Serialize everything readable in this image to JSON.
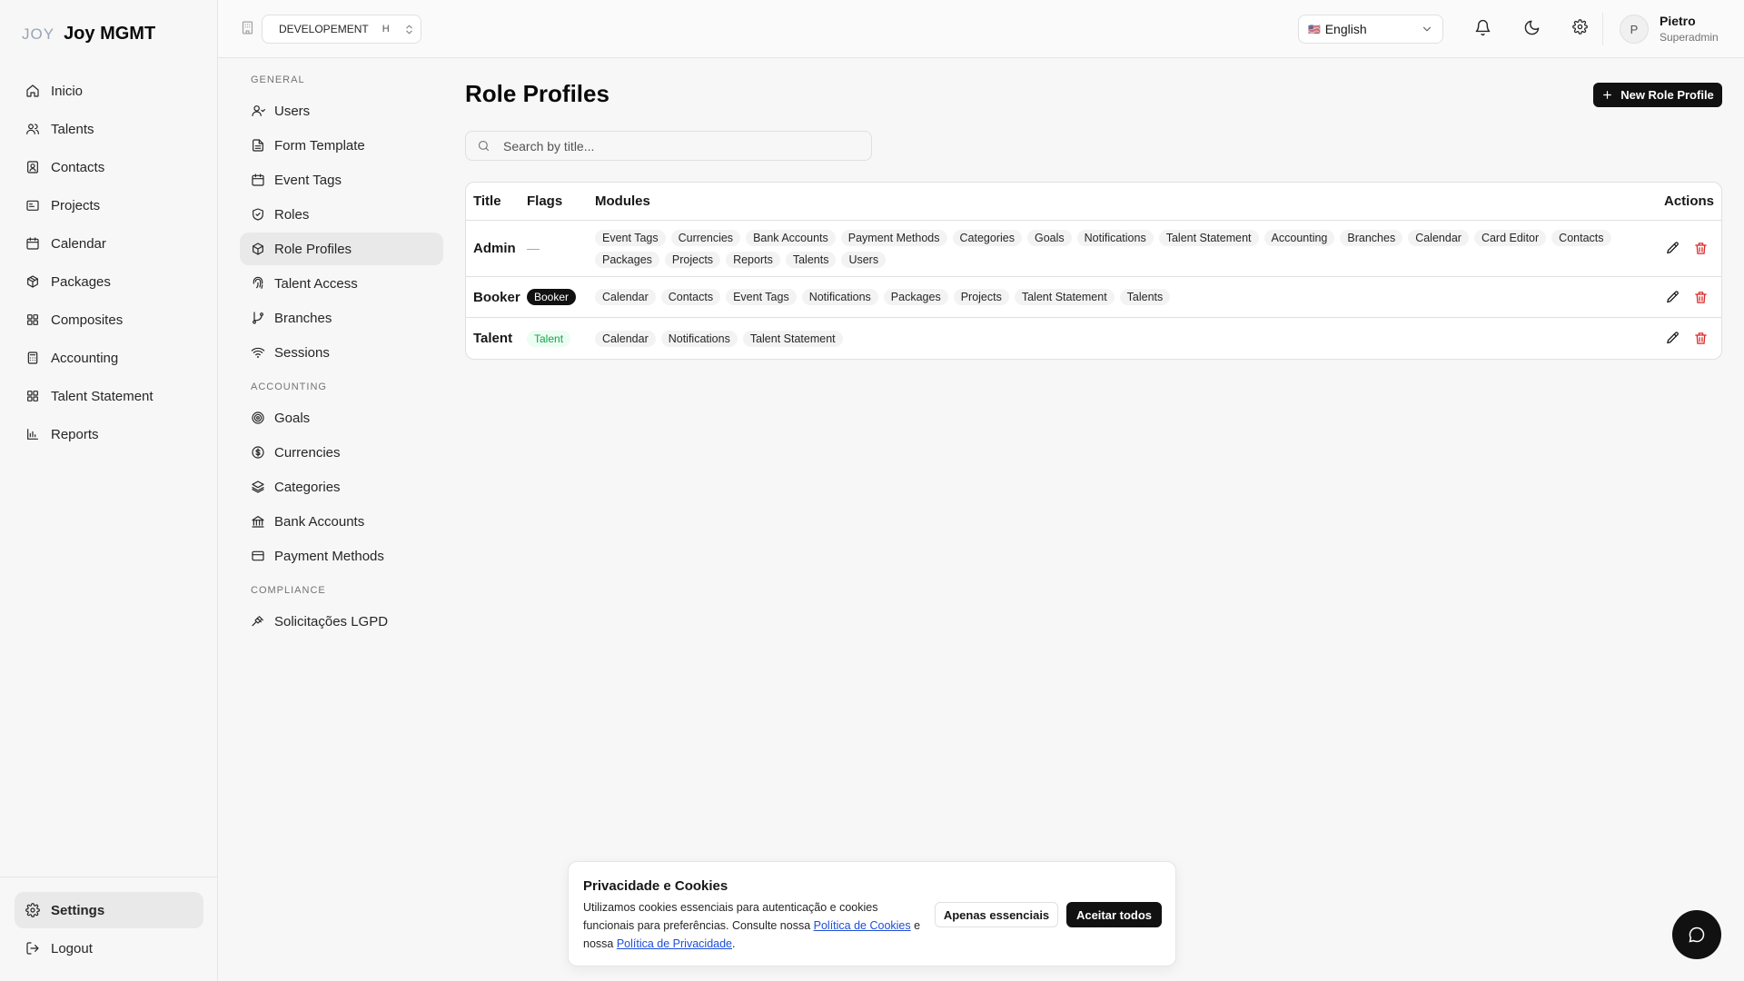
{
  "brand": {
    "mark": "JOY",
    "name": "Joy MGMT"
  },
  "nav": {
    "items": [
      {
        "label": "Inicio",
        "icon": "home-icon"
      },
      {
        "label": "Talents",
        "icon": "users-icon"
      },
      {
        "label": "Contacts",
        "icon": "contact-icon"
      },
      {
        "label": "Projects",
        "icon": "folder-icon"
      },
      {
        "label": "Calendar",
        "icon": "calendar-icon"
      },
      {
        "label": "Packages",
        "icon": "package-icon"
      },
      {
        "label": "Composites",
        "icon": "grid-icon"
      },
      {
        "label": "Accounting",
        "icon": "calculator-icon"
      },
      {
        "label": "Talent Statement",
        "icon": "grid-icon"
      },
      {
        "label": "Reports",
        "icon": "chart-icon"
      }
    ],
    "settings": "Settings",
    "logout": "Logout"
  },
  "topbar": {
    "environment": "DEVELOPEMENT",
    "environment_badge": "H",
    "language": "English",
    "language_flag": "🇺🇸",
    "user_initial": "P",
    "user_name": "Pietro",
    "user_role": "Superadmin"
  },
  "subnav": {
    "general_heading": "GENERAL",
    "general": [
      "Users",
      "Form Template",
      "Event Tags",
      "Roles",
      "Role Profiles",
      "Talent Access",
      "Branches",
      "Sessions"
    ],
    "accounting_heading": "ACCOUNTING",
    "accounting": [
      "Goals",
      "Currencies",
      "Categories",
      "Bank Accounts",
      "Payment Methods"
    ],
    "compliance_heading": "COMPLIANCE",
    "compliance": [
      "Solicitações LGPD"
    ]
  },
  "main": {
    "title": "Role Profiles",
    "new_button": "New Role Profile",
    "search_placeholder": "Search by title...",
    "columns": {
      "title": "Title",
      "flags": "Flags",
      "modules": "Modules",
      "actions": "Actions"
    },
    "rows": [
      {
        "title": "Admin",
        "flag": "—",
        "modules": [
          "Event Tags",
          "Currencies",
          "Bank Accounts",
          "Payment Methods",
          "Categories",
          "Goals",
          "Notifications",
          "Talent Statement",
          "Accounting",
          "Branches",
          "Calendar",
          "Card Editor",
          "Contacts",
          "Packages",
          "Projects",
          "Reports",
          "Talents",
          "Users"
        ]
      },
      {
        "title": "Booker",
        "flag": "Booker",
        "modules": [
          "Calendar",
          "Contacts",
          "Event Tags",
          "Notifications",
          "Packages",
          "Projects",
          "Talent Statement",
          "Talents"
        ]
      },
      {
        "title": "Talent",
        "flag": "Talent",
        "modules": [
          "Calendar",
          "Notifications",
          "Talent Statement"
        ]
      }
    ]
  },
  "cookie": {
    "title": "Privacidade e Cookies",
    "text_1": "Utilizamos cookies essenciais para autenticação e cookies funcionais para preferências. Consulte nossa ",
    "link_1": "Política de Cookies",
    "text_2": " e nossa ",
    "link_2": "Política de Privacidade",
    "text_3": ".",
    "essential_button": "Apenas essenciais",
    "accept_button": "Aceitar todos"
  },
  "colors": {
    "accent": "#111111",
    "danger": "#dc2626",
    "success": "#16a34a",
    "link": "#1d4ed8"
  }
}
